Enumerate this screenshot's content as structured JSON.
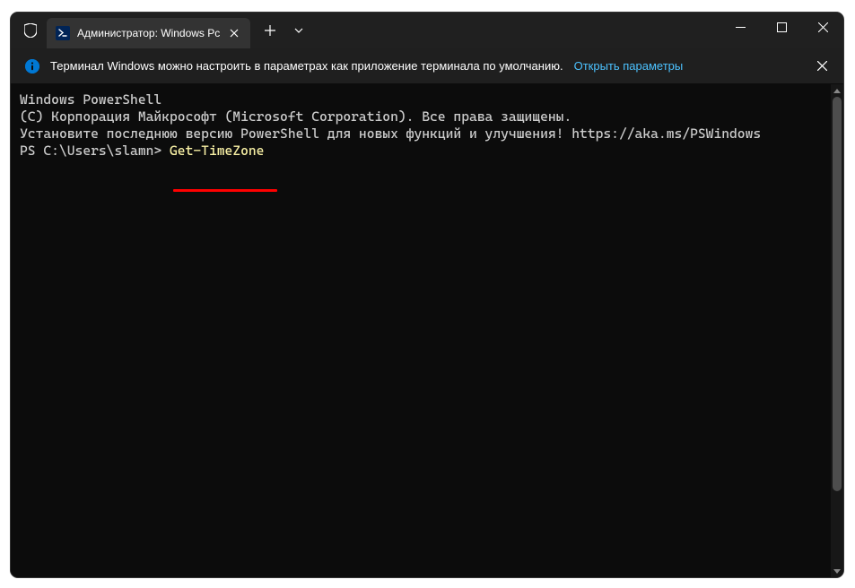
{
  "tab": {
    "title": "Администратор: Windows Pc"
  },
  "infoBar": {
    "text": "Терминал Windows можно настроить в параметрах как приложение терминала по умолчанию.",
    "link": "Открыть параметры"
  },
  "terminal": {
    "line1": "Windows PowerShell",
    "line2": "(C) Корпорация Майкрософт (Microsoft Corporation). Все права защищены.",
    "line3": "",
    "line4": "Установите последнюю версию PowerShell для новых функций и улучшения! https://aka.ms/PSWindows",
    "line5": "",
    "promptPrefix": "PS C:\\Users\\slamn> ",
    "command": "Get-TimeZone"
  }
}
